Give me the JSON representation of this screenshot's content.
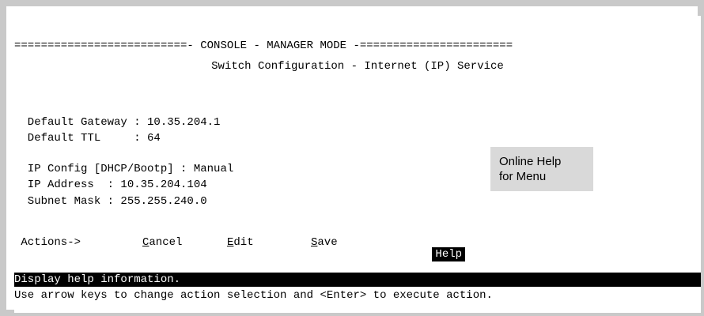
{
  "console": {
    "header_banner": "==========================- CONSOLE - MANAGER MODE -=======================",
    "screen_title": "Switch Configuration - Internet (IP) Service"
  },
  "fields": {
    "default_gateway": "  Default Gateway : 10.35.204.1",
    "default_ttl": "  Default TTL     : 64",
    "ip_config": "  IP Config [DHCP/Bootp] : Manual",
    "ip_address": "  IP Address  : 10.35.204.104",
    "subnet_mask": "  Subnet Mask : 255.255.240.0"
  },
  "actions": {
    "prefix": " Actions->",
    "cancel": "Cancel",
    "edit": "Edit",
    "save": "Save",
    "help": "Help",
    "selected": "help"
  },
  "status": {
    "help_line": "Display help information.",
    "instruction_line": "Use arrow keys to change action selection and <Enter> to execute action."
  },
  "callout": {
    "line1": "Online Help",
    "line2": "for Menu"
  }
}
